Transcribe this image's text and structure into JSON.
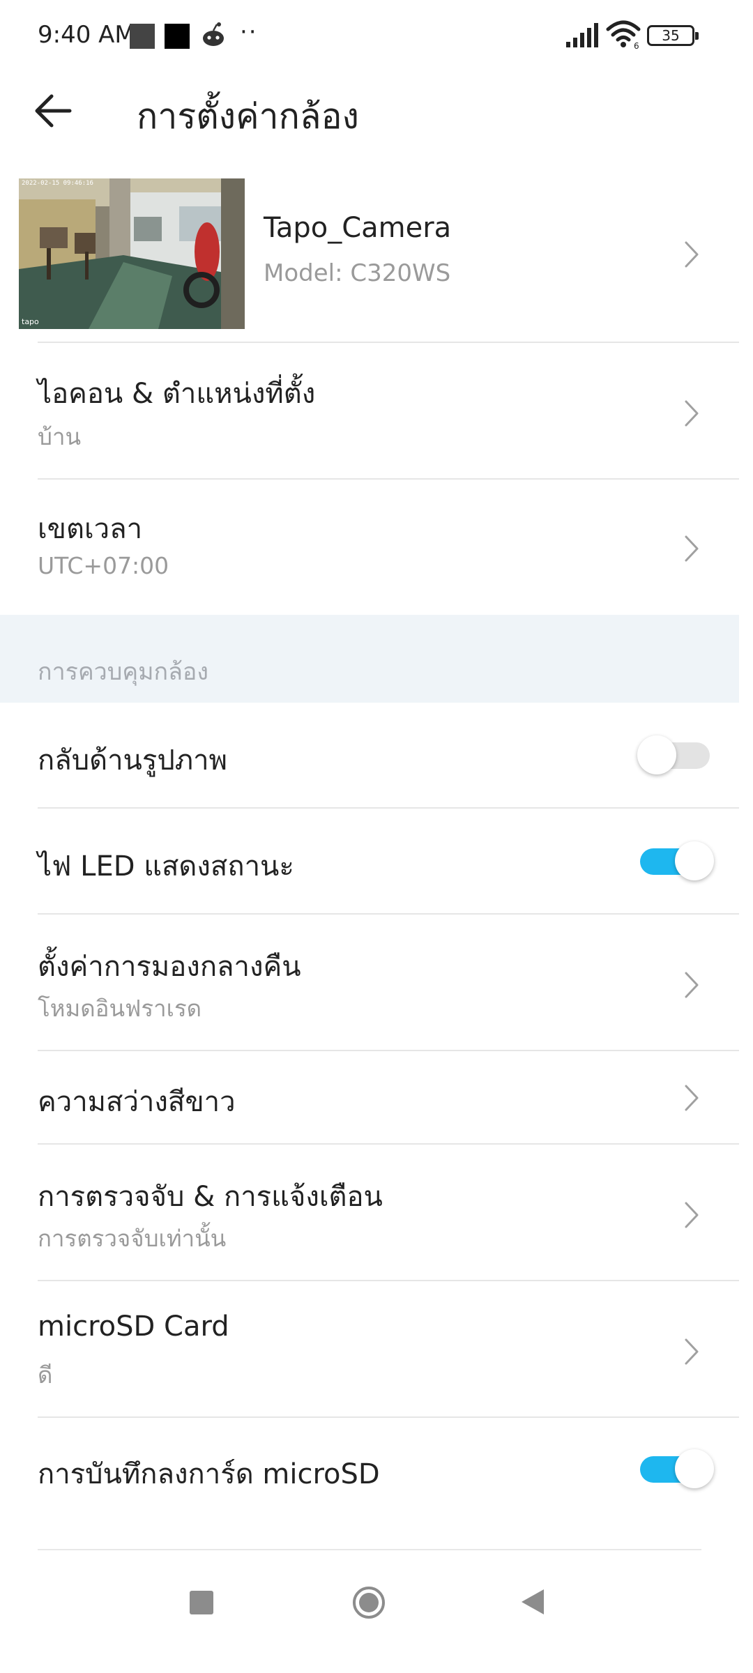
{
  "status_bar": {
    "time": "9:40 AM",
    "dots": "··",
    "battery": "35",
    "icons": [
      "gallery-square-icon",
      "black-square-icon",
      "reddit-icon",
      "more-dots-icon",
      "signal-icon",
      "wifi-6-icon",
      "battery-icon"
    ]
  },
  "header": {
    "title": "การตั้งค่ากล้อง",
    "back_icon": "arrow-left-icon"
  },
  "camera": {
    "name": "Tapo_Camera",
    "model": "Model: C320WS",
    "thumbnail_timestamp": "2022-02-15 09:46:16",
    "thumbnail_logo": "tapo"
  },
  "rows": {
    "icon_location": {
      "title": "ไอคอน & ตำแหน่งที่ตั้ง",
      "subtitle": "บ้าน"
    },
    "timezone": {
      "title": "เขตเวลา",
      "subtitle": "UTC+07:00"
    }
  },
  "section": {
    "title": "การควบคุมกล้อง"
  },
  "controls": {
    "flip_image": {
      "title": "กลับด้านรูปภาพ",
      "enabled": false
    },
    "status_led": {
      "title": "ไฟ LED แสดงสถานะ",
      "enabled": true
    },
    "night_vision": {
      "title": "ตั้งค่าการมองกลางคืน",
      "subtitle": "โหมดอินฟราเรด"
    },
    "white_brightness": {
      "title": "ความสว่างสีขาว"
    },
    "detection_alerts": {
      "title": "การตรวจจับ & การแจ้งเตือน",
      "subtitle": "การตรวจจับเท่านั้น"
    },
    "microsd_card": {
      "title": "microSD Card",
      "subtitle": "ดี"
    },
    "microsd_recording": {
      "title": "การบันทึกลงการ์ด microSD",
      "enabled": true
    }
  },
  "colors": {
    "accent": "#1eb7ef",
    "section_background": "#eff4f8",
    "secondary_text": "#9a9a9a",
    "divider": "#e6e6e6"
  },
  "nav_bar": {
    "icons": [
      "recent-apps-square-icon",
      "home-circle-icon",
      "back-triangle-icon"
    ]
  }
}
